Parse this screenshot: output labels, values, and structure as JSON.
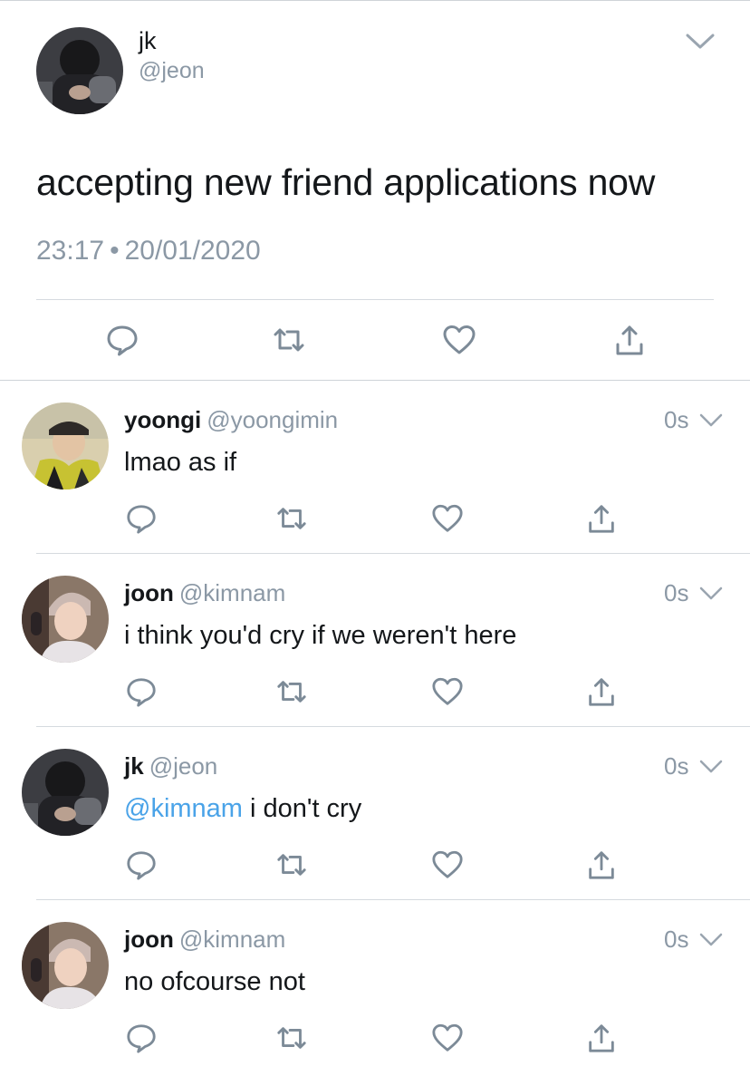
{
  "main_tweet": {
    "name": "jk",
    "handle": "@jeon",
    "text": "accepting new friend applications now",
    "time": "23:17",
    "separator": "•",
    "date": "20/01/2020"
  },
  "icons": {
    "reply": "reply-icon",
    "retweet": "retweet-icon",
    "like": "heart-icon",
    "share": "share-icon",
    "more": "chevron-down-icon"
  },
  "colors": {
    "text": "#14171a",
    "secondary": "#8b98a5",
    "mention": "#4aa3e8",
    "icon": "#7c8a97",
    "divider": "#d5dadf"
  },
  "replies": [
    {
      "name": "yoongi",
      "handle": "@yoongimin",
      "time": "0s",
      "text": "lmao as if",
      "mention": "",
      "avatar": "yoongi"
    },
    {
      "name": "joon",
      "handle": "@kimnam",
      "time": "0s",
      "text": "i think you'd cry if we weren't here",
      "mention": "",
      "avatar": "joon"
    },
    {
      "name": "jk",
      "handle": "@jeon",
      "time": "0s",
      "text": "i don't cry",
      "mention": "@kimnam",
      "avatar": "jk"
    },
    {
      "name": "joon",
      "handle": "@kimnam",
      "time": "0s",
      "text": "no ofcourse not",
      "mention": "",
      "avatar": "joon"
    }
  ]
}
